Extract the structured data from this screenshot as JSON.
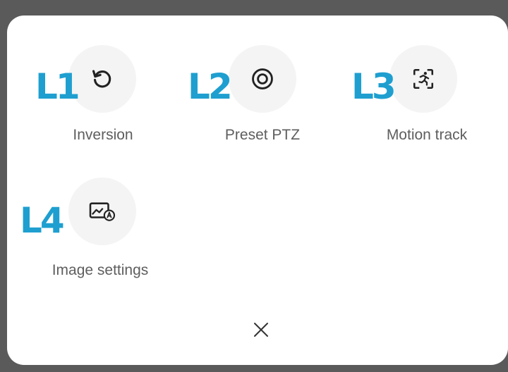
{
  "menu": {
    "items": [
      {
        "label": "Inversion",
        "icon": "rotate-ccw-icon",
        "tag": "L1"
      },
      {
        "label": "Preset PTZ",
        "icon": "target-icon",
        "tag": "L2"
      },
      {
        "label": "Motion track",
        "icon": "motion-track-icon",
        "tag": "L3"
      },
      {
        "label": "Image settings",
        "icon": "image-auto-icon",
        "tag": "L4"
      }
    ],
    "close_icon": "close-icon"
  },
  "colors": {
    "backdrop": "#5a5a5a",
    "sheet": "#ffffff",
    "icon_circle": "#f4f4f4",
    "label_text": "#5e5e5e",
    "tag_overlay": "#1e9fd0"
  }
}
